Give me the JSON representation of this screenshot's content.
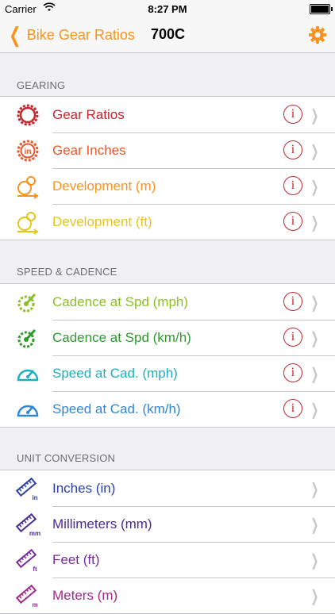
{
  "status": {
    "carrier": "Carrier",
    "time": "8:27 PM"
  },
  "nav": {
    "back_label": "Bike Gear Ratios",
    "title": "700C"
  },
  "sections": [
    {
      "header": "GEARING",
      "rows": [
        {
          "label": "Gear Ratios",
          "color": "#c1272d",
          "icon": "chainring-icon",
          "info": "i"
        },
        {
          "label": "Gear Inches",
          "color": "#e8562a",
          "icon": "gear-inches-icon",
          "info": "i"
        },
        {
          "label": "Development (m)",
          "color": "#f7931e",
          "icon": "development-icon",
          "info": "i"
        },
        {
          "label": "Development (ft)",
          "color": "#e6c619",
          "icon": "development-icon",
          "info": "i"
        }
      ]
    },
    {
      "header": "SPEED & CADENCE",
      "rows": [
        {
          "label": "Cadence at Spd (mph)",
          "color": "#8cbf26",
          "icon": "crank-icon",
          "info": "i"
        },
        {
          "label": "Cadence at Spd (km/h)",
          "color": "#2e9b2e",
          "icon": "crank-icon",
          "info": "i"
        },
        {
          "label": "Speed at Cad. (mph)",
          "color": "#1ab0c0",
          "icon": "speedometer-icon",
          "info": "i"
        },
        {
          "label": "Speed at Cad. (km/h)",
          "color": "#2e86d6",
          "icon": "speedometer-icon",
          "info": "i"
        }
      ]
    },
    {
      "header": "UNIT CONVERSION",
      "rows": [
        {
          "label": "Inches (in)",
          "color": "#2a3fa8",
          "icon": "ruler-icon",
          "unit": "in"
        },
        {
          "label": "Millimeters (mm)",
          "color": "#4b2a98",
          "icon": "ruler-icon",
          "unit": "mm"
        },
        {
          "label": "Feet (ft)",
          "color": "#7a2aa0",
          "icon": "ruler-icon",
          "unit": "ft"
        },
        {
          "label": "Meters (m)",
          "color": "#a02a8a",
          "icon": "ruler-icon",
          "unit": "m"
        }
      ]
    }
  ]
}
